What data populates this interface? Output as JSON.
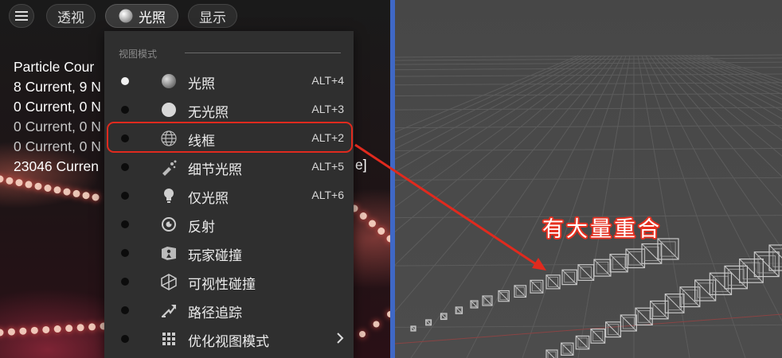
{
  "toolbar": {
    "menu_icon": "hamburger-icon",
    "perspective_label": "透视",
    "lit_label": "光照",
    "show_label": "显示"
  },
  "stats": {
    "lines": [
      "Particle Cour",
      "8 Current, 9 N",
      "0 Current, 0 N",
      "0 Current, 0 N",
      "0 Current, 0 N",
      "23046 Curren"
    ],
    "overflow_fragment": "e]"
  },
  "view_mode_menu": {
    "section_title": "视图模式",
    "items": [
      {
        "label": "光照",
        "shortcut": "ALT+4",
        "icon": "lit-sphere-icon",
        "selected": true
      },
      {
        "label": "无光照",
        "shortcut": "ALT+3",
        "icon": "unlit-sphere-icon",
        "selected": false
      },
      {
        "label": "线框",
        "shortcut": "ALT+2",
        "icon": "wireframe-globe-icon",
        "selected": false
      },
      {
        "label": "细节光照",
        "shortcut": "ALT+5",
        "icon": "detail-lighting-icon",
        "selected": false
      },
      {
        "label": "仅光照",
        "shortcut": "ALT+6",
        "icon": "lightbulb-icon",
        "selected": false
      },
      {
        "label": "反射",
        "shortcut": "",
        "icon": "reflection-icon",
        "selected": false
      },
      {
        "label": "玩家碰撞",
        "shortcut": "",
        "icon": "player-collision-icon",
        "selected": false
      },
      {
        "label": "可视性碰撞",
        "shortcut": "",
        "icon": "visibility-collision-icon",
        "selected": false
      },
      {
        "label": "路径追踪",
        "shortcut": "",
        "icon": "path-tracing-icon",
        "selected": false
      },
      {
        "label": "优化视图模式",
        "shortcut": "",
        "icon": "optimization-grid-icon",
        "selected": false,
        "submenu": true
      }
    ]
  },
  "annotation": {
    "callout_text": "有大量重合",
    "highlight_color": "#e02a1e"
  },
  "colors": {
    "viewport_divider": "#3f68c6",
    "menu_bg": "#2f2f2f",
    "wireframe_bg": "#4a4a4a"
  }
}
